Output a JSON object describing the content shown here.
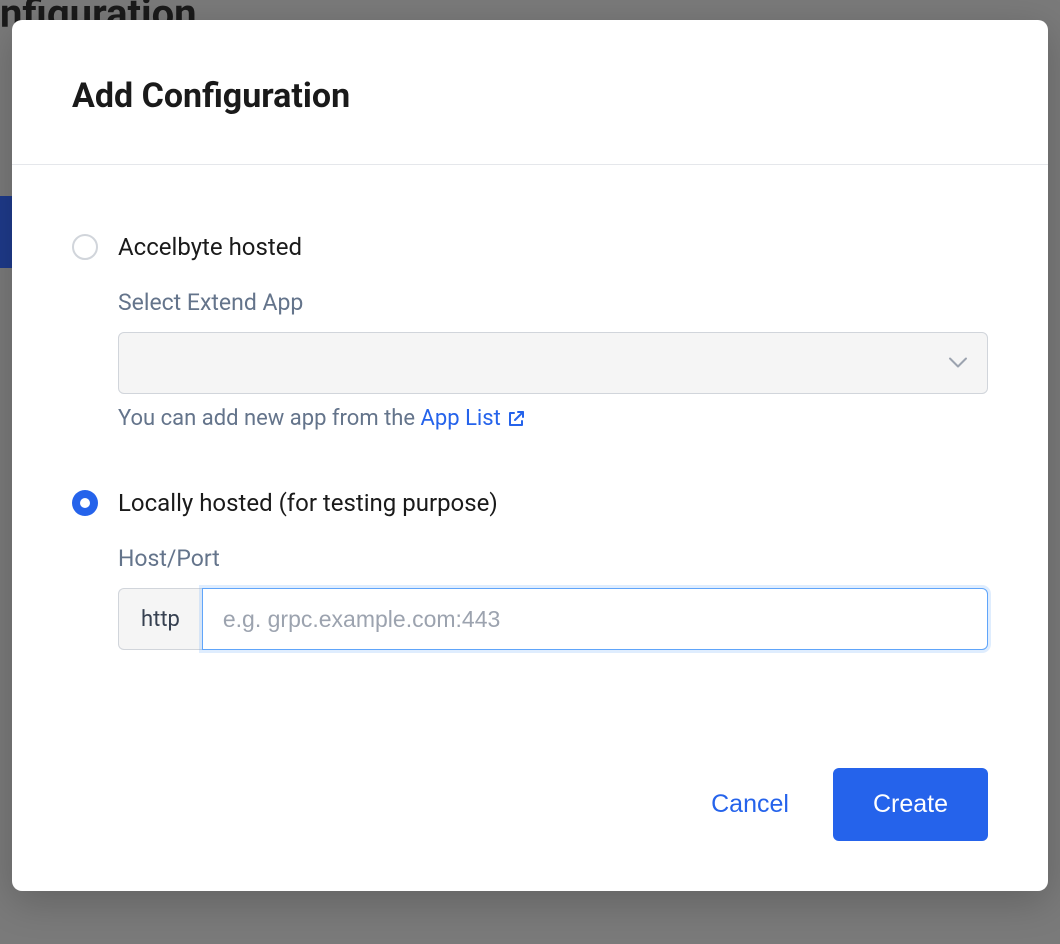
{
  "background": {
    "title_partial": "nfiguration"
  },
  "modal": {
    "title": "Add Configuration",
    "options": {
      "accelbyte": {
        "label": "Accelbyte hosted",
        "selected": false,
        "sub_label": "Select Extend App",
        "select_value": "",
        "help_text_prefix": "You can add new app from the ",
        "help_link_text": "App List"
      },
      "local": {
        "label": "Locally hosted (for testing purpose)",
        "selected": true,
        "sub_label": "Host/Port",
        "input_prefix": "http",
        "input_placeholder": "e.g. grpc.example.com:443",
        "input_value": ""
      }
    },
    "footer": {
      "cancel_label": "Cancel",
      "create_label": "Create"
    }
  }
}
